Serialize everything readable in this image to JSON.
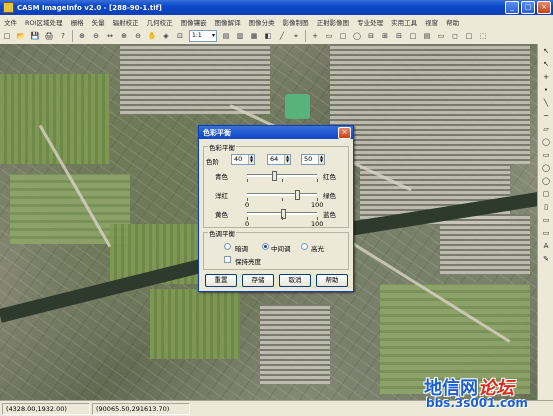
{
  "window": {
    "title": "CASM ImageInfo v2.0  - [288-90-1.tif]",
    "min_glyph": "_",
    "max_glyph": "□",
    "close_glyph": "×"
  },
  "menu": [
    "文件",
    "ROI区域处理",
    "栅格",
    "矢量",
    "辐射校正",
    "几何校正",
    "图像镶嵌",
    "图像解译",
    "图像分类",
    "影像制图",
    "正射影像图",
    "专业处理",
    "实用工具",
    "视窗",
    "帮助"
  ],
  "toolbar": {
    "buttons_left": [
      "□",
      "📂",
      "💾",
      "🖨",
      "?"
    ],
    "zoom_buttons": [
      "⊕",
      "⊖",
      "↔",
      "⊕",
      "⊖",
      "✋",
      "◈",
      "⊡"
    ],
    "zoom_value": "1:1",
    "buttons_right": [
      "▤",
      "▥",
      "▦",
      "◧",
      "╱",
      "⌖",
      "+",
      "▭",
      "□",
      "◯",
      "⊟",
      "⊞",
      "⊟",
      "□",
      "▤",
      "▭",
      "◻",
      "□",
      "⬚"
    ]
  },
  "right_toolbar": [
    "↖",
    "↖",
    "+",
    "•",
    "╲",
    "~",
    "▱",
    "◯",
    "▭",
    "◯",
    "◯",
    "▢",
    "▯",
    "▭",
    "▭",
    "A",
    "✎"
  ],
  "dialog": {
    "title": "色彩平衡",
    "close_glyph": "×",
    "group_balance": "色彩平衡",
    "level_label": "色阶",
    "levels": [
      "40",
      "64",
      "50"
    ],
    "rows": [
      {
        "left": "青色",
        "right": "红色",
        "value": 0.38
      },
      {
        "left": "洋红",
        "right": "绿色",
        "value": 0.72
      },
      {
        "left": "黄色",
        "right": "蓝色",
        "value": 0.52
      }
    ],
    "scale_min": "0",
    "scale_max": "100",
    "group_tone": "色调平衡",
    "tones": [
      {
        "label": "暗调",
        "selected": false
      },
      {
        "label": "中间调",
        "selected": true
      },
      {
        "label": "高光",
        "selected": false
      }
    ],
    "preserve_label": "保持亮度",
    "buttons": [
      "重置",
      "存储",
      "取消",
      "帮助"
    ]
  },
  "status": {
    "pixel": "(4328.00,1932.00)",
    "coords": "(90065.50,291613.70)"
  },
  "watermark": {
    "cn": "地信网",
    "cn_red": "论坛",
    "url": "bbs.3s001.com"
  }
}
